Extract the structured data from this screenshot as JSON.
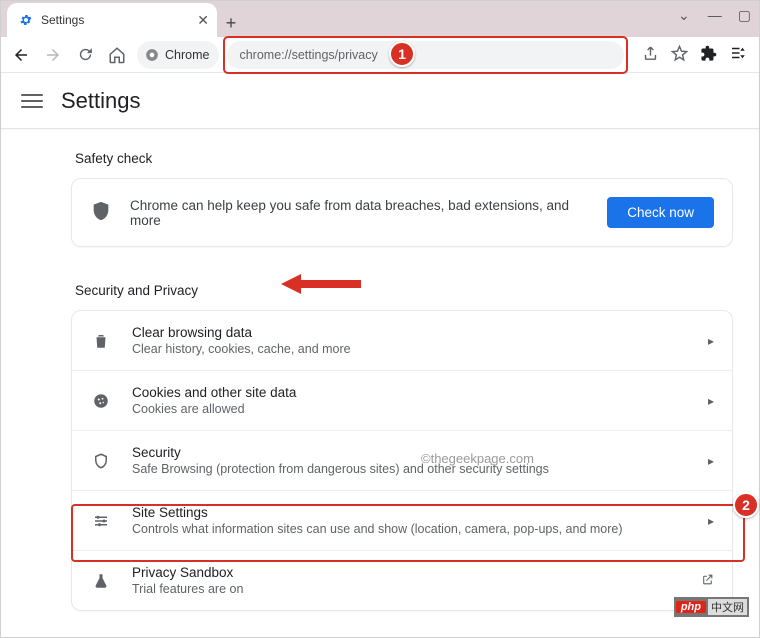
{
  "tab": {
    "title": "Settings"
  },
  "url_bar": {
    "origin_label": "Chrome",
    "url": "chrome://settings/privacy"
  },
  "settings_header": {
    "title": "Settings"
  },
  "safety": {
    "heading": "Safety check",
    "text": "Chrome can help keep you safe from data breaches, bad extensions, and more",
    "button": "Check now"
  },
  "security_heading": "Security and Privacy",
  "rows": [
    {
      "title": "Clear browsing data",
      "subtitle": "Clear history, cookies, cache, and more"
    },
    {
      "title": "Cookies and other site data",
      "subtitle": "Cookies are allowed"
    },
    {
      "title": "Security",
      "subtitle": "Safe Browsing (protection from dangerous sites) and other security settings"
    },
    {
      "title": "Site Settings",
      "subtitle": "Controls what information sites can use and show (location, camera, pop-ups, and more)"
    },
    {
      "title": "Privacy Sandbox",
      "subtitle": "Trial features are on"
    }
  ],
  "annotations": {
    "badge1": "1",
    "badge2": "2"
  },
  "watermark": "©thegeekpage.com",
  "footer_tag": {
    "brand": "php",
    "cn": "中文网"
  }
}
